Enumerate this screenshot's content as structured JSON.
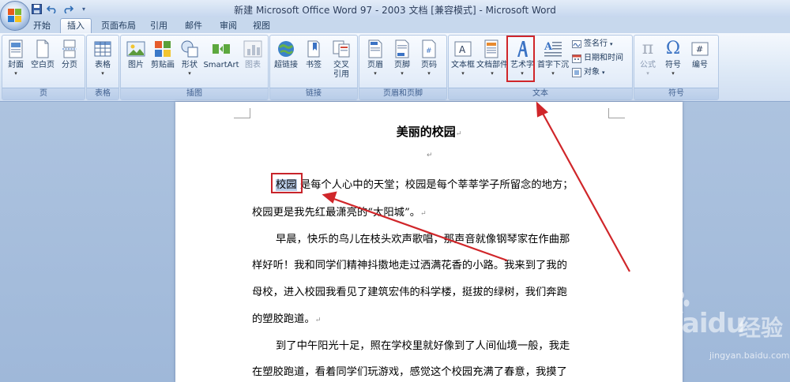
{
  "window": {
    "title": "新建 Microsoft Office Word 97 - 2003 文档 [兼容模式] - Microsoft Word"
  },
  "quick_access": {
    "icons": [
      "save-icon",
      "undo-icon",
      "redo-icon",
      "customize-icon"
    ]
  },
  "tabs": [
    {
      "label": "开始"
    },
    {
      "label": "插入",
      "active": true
    },
    {
      "label": "页面布局"
    },
    {
      "label": "引用"
    },
    {
      "label": "邮件"
    },
    {
      "label": "审阅"
    },
    {
      "label": "视图"
    }
  ],
  "ribbon": {
    "groups": {
      "pages": {
        "label": "页",
        "buttons": [
          {
            "label": "封面",
            "dropdown": true,
            "icon": "cover-page-icon"
          },
          {
            "label": "空白页",
            "icon": "blank-page-icon"
          },
          {
            "label": "分页",
            "icon": "page-break-icon"
          }
        ]
      },
      "tables": {
        "label": "表格",
        "buttons": [
          {
            "label": "表格",
            "dropdown": true,
            "icon": "table-icon"
          }
        ]
      },
      "illustrations": {
        "label": "插图",
        "buttons": [
          {
            "label": "图片",
            "icon": "picture-icon"
          },
          {
            "label": "剪贴画",
            "icon": "clip-art-icon"
          },
          {
            "label": "形状",
            "dropdown": true,
            "icon": "shapes-icon"
          },
          {
            "label": "SmartArt",
            "icon": "smartart-icon"
          },
          {
            "label": "图表",
            "icon": "chart-icon",
            "disabled": true
          }
        ]
      },
      "links": {
        "label": "链接",
        "buttons": [
          {
            "label": "超链接",
            "icon": "hyperlink-icon"
          },
          {
            "label": "书签",
            "icon": "bookmark-icon"
          },
          {
            "label": "交叉",
            "label2": "引用",
            "icon": "cross-reference-icon"
          }
        ]
      },
      "header_footer": {
        "label": "页眉和页脚",
        "buttons": [
          {
            "label": "页眉",
            "dropdown": true,
            "icon": "header-icon"
          },
          {
            "label": "页脚",
            "dropdown": true,
            "icon": "footer-icon"
          },
          {
            "label": "页码",
            "dropdown": true,
            "icon": "page-number-icon"
          }
        ]
      },
      "text": {
        "label": "文本",
        "buttons": [
          {
            "label": "文本框",
            "dropdown": true,
            "icon": "text-box-icon"
          },
          {
            "label": "文档部件",
            "dropdown": true,
            "icon": "quick-parts-icon"
          },
          {
            "label": "艺术字",
            "dropdown": true,
            "icon": "wordart-icon"
          },
          {
            "label": "首字下沉",
            "dropdown": true,
            "icon": "drop-cap-icon"
          }
        ],
        "small_buttons": [
          {
            "label": "签名行",
            "dropdown": true,
            "icon": "signature-line-icon"
          },
          {
            "label": "日期和时间",
            "icon": "date-time-icon"
          },
          {
            "label": "对象",
            "dropdown": true,
            "icon": "object-icon"
          }
        ]
      },
      "symbols": {
        "label": "符号",
        "buttons": [
          {
            "label": "公式",
            "dropdown": true,
            "icon": "equation-icon",
            "disabled": true
          },
          {
            "label": "符号",
            "dropdown": true,
            "icon": "symbol-icon"
          },
          {
            "label": "编号",
            "icon": "number-icon"
          }
        ]
      }
    }
  },
  "document": {
    "title": "美丽的校园",
    "selected_word": "校园",
    "lines": [
      {
        "text": " 是每个人心中的天堂；校园是每个莘莘学子所留念的地方；",
        "indent": true,
        "has_selection": true
      },
      {
        "text": "校园更是我先红最潇亮的“太阳城”。",
        "indent": false,
        "para_end": true
      },
      {
        "text": "早晨，快乐的鸟儿在枝头欢声歌唱，那声音就像钢琴家在作曲那",
        "indent": true
      },
      {
        "text": "样好听！我和同学们精神抖擞地走过洒满花香的小路。我来到了我的",
        "indent": false
      },
      {
        "text": "母校，进入校园我看见了建筑宏伟的科学楼，挺拔的绿树，我们奔跑",
        "indent": false
      },
      {
        "text": "的塑胶跑道。",
        "indent": false,
        "para_end": true
      },
      {
        "text": "到了中午阳光十足，照在学校里就好像到了人间仙境一般，我走",
        "indent": true
      },
      {
        "text": "在塑胶跑道，看着同学们玩游戏，感觉这个校园充满了春意，我摸了",
        "indent": false
      }
    ],
    "paragraph_mark": "↵"
  },
  "annotations": {
    "color": "#d0262a"
  },
  "watermark": {
    "brand": "Baidu",
    "brand_cn": "经验",
    "url": "jingyan.baidu.com"
  }
}
